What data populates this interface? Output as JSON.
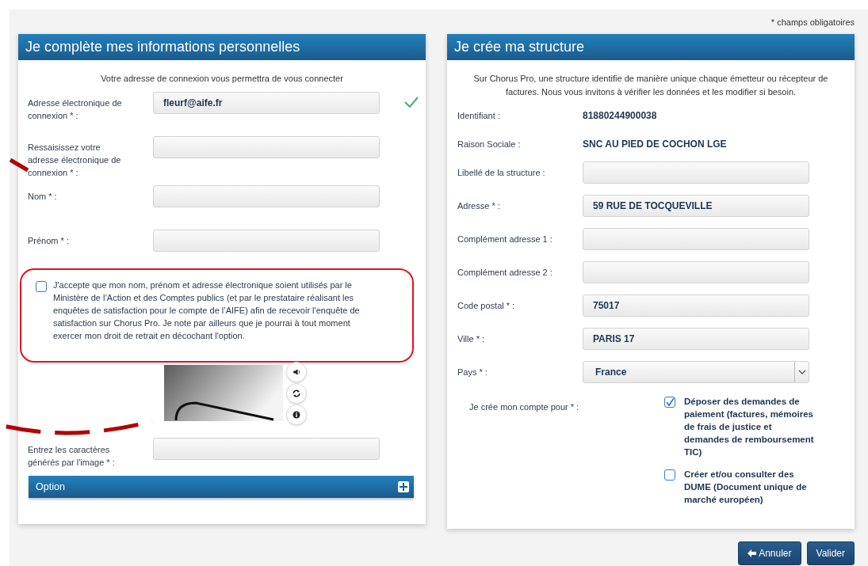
{
  "note": "* champs obligatoires",
  "personal": {
    "title": "Je complète mes informations personnelles",
    "intro": "Votre adresse de connexion vous permettra de vous connecter",
    "fields": [
      {
        "label": "Adresse électronique de connexion * :",
        "value": "fleurf@aife.fr",
        "valid": true
      },
      {
        "label": "Ressaisissez votre adresse électronique de connexion * :",
        "valid": false
      },
      {
        "label": "Nom * :",
        "valid": false
      },
      {
        "label": "Prénom * :",
        "valid": false
      }
    ],
    "consent": {
      "text": "J'accepte que mon nom, prénom et adresse électronique soient utilisés par le Ministère de l’Action et des Comptes publics (et par le prestataire réalisant les enquêtes de satisfaction pour le compte de l’AIFE) afin de recevoir l'enquête de satisfaction sur Chorus Pro. Je note par ailleurs que je pourrai à tout moment exercer mon droit de retrait en décochant l'option.",
      "checked": false
    },
    "captcha": {
      "label": "Entrez les caractères générés par l'image * :"
    },
    "option": {
      "label": "Option",
      "expanded": false
    }
  },
  "structure": {
    "title": "Je crée ma structure",
    "intro": "Sur Chorus Pro, une structure identifie de manière unique chaque émetteur ou récepteur de factures. Nous vous invitons à vérifier les données et les modifier si besoin.",
    "fields": [
      {
        "kind": "static",
        "label": "Identifiant :",
        "value": "81880244900038"
      },
      {
        "kind": "static",
        "label": "Raison Sociale :",
        "value": "SNC AU PIED DE COCHON LGE"
      },
      {
        "kind": "input",
        "label": "Libellé de la structure :"
      },
      {
        "kind": "input",
        "label": "Adresse * :",
        "value": "59 RUE DE TOCQUEVILLE"
      },
      {
        "kind": "input",
        "label": "Complément adresse 1 :"
      },
      {
        "kind": "input",
        "label": "Complément adresse 2 :"
      },
      {
        "kind": "input",
        "label": "Code postal * :",
        "value": "75017"
      },
      {
        "kind": "input",
        "label": "Ville * :",
        "value": "PARIS 17"
      },
      {
        "kind": "select",
        "label": "Pays * :",
        "value": "France"
      }
    ],
    "account": {
      "label": "Je crée mon compte pour * :",
      "choices": [
        {
          "text": "Déposer des demandes de paiement (factures, mémoires de frais de justice et demandes de remboursement TIC)",
          "checked": true
        },
        {
          "text": "Créer et/ou consulter des DUME (Document unique de marché européen)",
          "checked": false
        }
      ]
    }
  },
  "buttons": [
    {
      "kind": "back",
      "label": "Annuler"
    },
    {
      "kind": "submit",
      "label": "Valider"
    }
  ]
}
